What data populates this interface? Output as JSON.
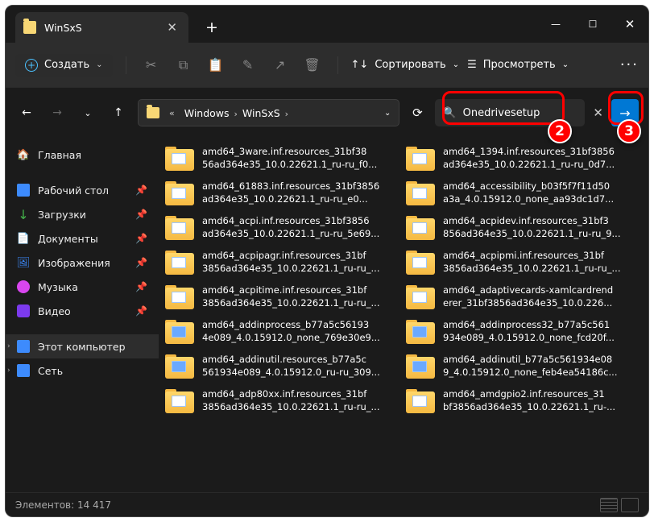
{
  "window": {
    "tab_title": "WinSxS",
    "min": "—",
    "max": "☐",
    "close": "✕"
  },
  "toolbar": {
    "create_label": "Создать",
    "sort_label": "Сортировать",
    "view_label": "Просмотреть"
  },
  "breadcrumb": {
    "chevrons": "«",
    "segments": [
      "Windows",
      "WinSxS"
    ],
    "sep": "›"
  },
  "search": {
    "value": "Onedrivesetup",
    "clear": "✕"
  },
  "sidebar": {
    "home": "Главная",
    "desktop": "Рабочий стол",
    "downloads": "Загрузки",
    "documents": "Документы",
    "images": "Изображения",
    "music": "Музыка",
    "video": "Видео",
    "thispc": "Этот компьютер",
    "network": "Сеть"
  },
  "files": [
    {
      "l1": "amd64_3ware.inf.resources_31bf38",
      "l2": "56ad364e35_10.0.22621.1_ru-ru_f0..."
    },
    {
      "l1": "amd64_1394.inf.resources_31bf3856",
      "l2": "ad364e35_10.0.22621.1_ru-ru_0d7..."
    },
    {
      "l1": "amd64_61883.inf.resources_31bf3856",
      "l2": "ad364e35_10.0.22621.1_ru-ru_e0..."
    },
    {
      "l1": "amd64_accessibility_b03f5f7f11d50",
      "l2": "a3a_4.0.15912.0_none_aa93dc1d7..."
    },
    {
      "l1": "amd64_acpi.inf.resources_31bf3856",
      "l2": "ad364e35_10.0.22621.1_ru-ru_5e69..."
    },
    {
      "l1": "amd64_acpidev.inf.resources_31bf3",
      "l2": "856ad364e35_10.0.22621.1_ru-ru_9..."
    },
    {
      "l1": "amd64_acpipagr.inf.resources_31bf",
      "l2": "3856ad364e35_10.0.22621.1_ru-ru_..."
    },
    {
      "l1": "amd64_acpipmi.inf.resources_31bf",
      "l2": "3856ad364e35_10.0.22621.1_ru-ru_..."
    },
    {
      "l1": "amd64_acpitime.inf.resources_31bf",
      "l2": "3856ad364e35_10.0.22621.1_ru-ru_..."
    },
    {
      "l1": "amd64_adaptivecards-xamlcardrend",
      "l2": "erer_31bf3856ad364e35_10.0.226..."
    },
    {
      "l1": "amd64_addinprocess_b77a5c56193",
      "l2": "4e089_4.0.15912.0_none_769e30e9...",
      "blue": true
    },
    {
      "l1": "amd64_addinprocess32_b77a5c561",
      "l2": "934e089_4.0.15912.0_none_fcd20f...",
      "blue": true
    },
    {
      "l1": "amd64_addinutil.resources_b77a5c",
      "l2": "561934e089_4.0.15912.0_ru-ru_309...",
      "blue": true
    },
    {
      "l1": "amd64_addinutil_b77a5c561934e08",
      "l2": "9_4.0.15912.0_none_feb4ea54186c...",
      "blue": true
    },
    {
      "l1": "amd64_adp80xx.inf.resources_31bf",
      "l2": "3856ad364e35_10.0.22621.1_ru-ru_..."
    },
    {
      "l1": "amd64_amdgpio2.inf.resources_31",
      "l2": "bf3856ad364e35_10.0.22621.1_ru-..."
    }
  ],
  "status": {
    "elements_label": "Элементов:",
    "count": "14 417"
  },
  "annotations": {
    "b2": "2",
    "b3": "3"
  }
}
